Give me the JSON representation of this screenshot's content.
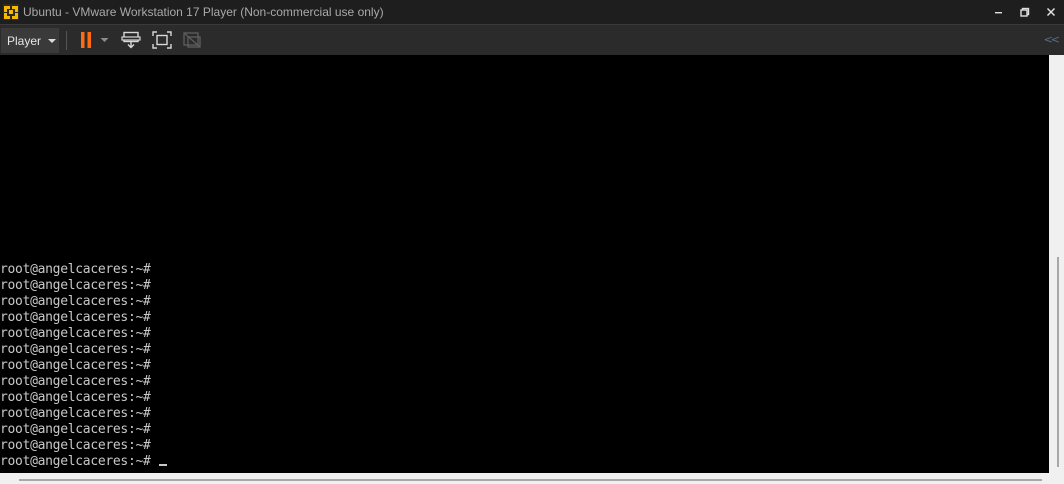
{
  "window": {
    "title": "Ubuntu - VMware Workstation 17 Player (Non-commercial use only)",
    "app_icon": "vmware-icon",
    "controls": [
      "minimize-icon",
      "restore-icon",
      "close-icon"
    ]
  },
  "toolbar": {
    "player_label": "Player",
    "icons": [
      "pause-icon",
      "pause-dropdown-icon",
      "send-ctrl-alt-del-icon",
      "full-screen-icon",
      "unity-icon",
      "collapse-toolbar-icon"
    ],
    "accent_color": "#ff6a13",
    "collapse_label": "<<"
  },
  "console": {
    "lines": [
      "root@angelcaceres:~#",
      "root@angelcaceres:~#",
      "root@angelcaceres:~#",
      "root@angelcaceres:~#",
      "root@angelcaceres:~#",
      "root@angelcaceres:~#",
      "root@angelcaceres:~#",
      "root@angelcaceres:~#",
      "root@angelcaceres:~#",
      "root@angelcaceres:~#",
      "root@angelcaceres:~#",
      "root@angelcaceres:~#",
      "root@angelcaceres:~#"
    ]
  }
}
